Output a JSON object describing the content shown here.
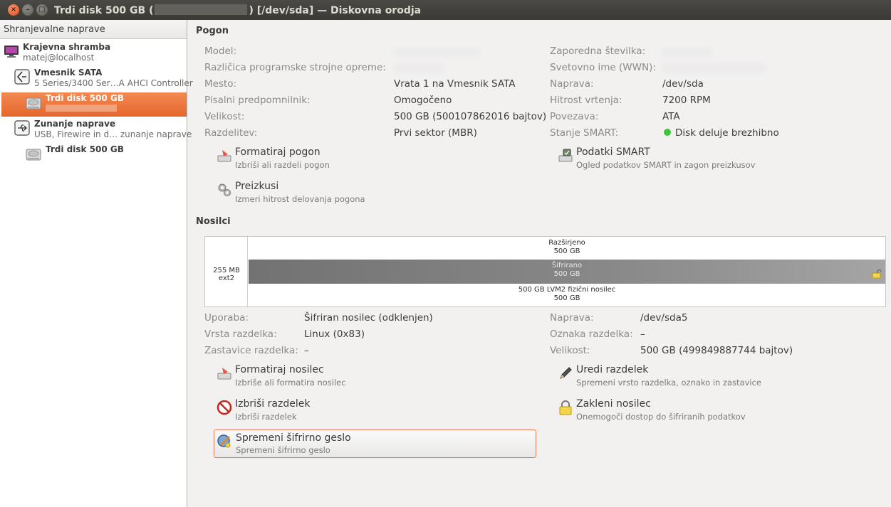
{
  "window": {
    "title_prefix": "Trdi disk 500 GB (",
    "title_suffix": ") [/dev/sda] — Diskovna orodja",
    "close_glyph": "×",
    "minimize_glyph": "–",
    "maximize_glyph": "□"
  },
  "sidebar": {
    "header": "Shranjevalne naprave",
    "items": [
      {
        "title": "Krajevna shramba",
        "subtitle": "matej@localhost",
        "icon": "computer-monitor-icon"
      },
      {
        "title": "Vmesnik SATA",
        "subtitle": "5 Series/3400 Ser…A AHCI Controller",
        "icon": "sata-controller-icon"
      },
      {
        "title": "Trdi disk 500 GB",
        "subtitle": "",
        "icon": "hard-disk-icon",
        "selected": true
      },
      {
        "title": "Zunanje naprave",
        "subtitle": "USB, Firewire in d… zunanje naprave",
        "icon": "usb-icon"
      },
      {
        "title": "Trdi disk 500 GB",
        "subtitle": "",
        "icon": "hard-disk-icon"
      }
    ]
  },
  "drive": {
    "section_title": "Pogon",
    "labels": {
      "model": "Model:",
      "firmware": "Različica programske strojne opreme:",
      "location": "Mesto:",
      "write_cache": "Pisalni predpomnilnik:",
      "size": "Velikost:",
      "partitioning": "Razdelitev:",
      "serial": "Zaporedna številka:",
      "wwn": "Svetovno ime (WWN):",
      "device": "Naprava:",
      "rotation": "Hitrost vrtenja:",
      "connection": "Povezava:",
      "smart_status": "Stanje SMART:"
    },
    "values": {
      "location": "Vrata 1 na Vmesnik SATA",
      "write_cache": "Omogočeno",
      "size": "500 GB (500107862016 bajtov)",
      "partitioning": "Prvi sektor (MBR)",
      "device": "/dev/sda",
      "rotation": "7200 RPM",
      "connection": "ATA",
      "smart_status": "Disk deluje brezhibno"
    },
    "actions": {
      "format_title": "Formatiraj pogon",
      "format_sub": "Izbriši ali razdeli pogon",
      "smart_title": "Podatki SMART",
      "smart_sub": "Ogled podatkov SMART in zagon preizkusov",
      "bench_title": "Preizkusi",
      "bench_sub": "Izmeri hitrost delovanja pogona"
    }
  },
  "volumes": {
    "section_title": "Nosilci",
    "graphic": {
      "part1": "255 MB ext2",
      "extended_name": "Razširjeno",
      "extended_size": "500 GB",
      "encrypted_name": "Šifrirano",
      "encrypted_size": "500 GB",
      "lvm_name": "500 GB LVM2 fizični nosilec",
      "lvm_size": "500 GB"
    },
    "labels": {
      "usage": "Uporaba:",
      "part_type": "Vrsta razdelka:",
      "part_flags": "Zastavice razdelka:",
      "device": "Naprava:",
      "part_label": "Oznaka razdelka:",
      "size": "Velikost:"
    },
    "values": {
      "usage": "Šifriran nosilec (odklenjen)",
      "part_type": "Linux (0x83)",
      "part_flags": "–",
      "device": "/dev/sda5",
      "part_label": "–",
      "size": "500 GB (499849887744 bajtov)"
    },
    "actions": {
      "format_title": "Formatiraj nosilec",
      "format_sub": "Izbriše ali formatira nosilec",
      "edit_title": "Uredi razdelek",
      "edit_sub": "Spremeni vrsto razdelka, oznako in zastavice",
      "delete_title": "Izbriši razdelek",
      "delete_sub": "Izbriši razdelek",
      "lock_title": "Zakleni nosilec",
      "lock_sub": "Onemogoči dostop do šifriranih podatkov",
      "pass_title": "Spremeni šifrirno geslo",
      "pass_sub": "Spremeni šifrirno geslo"
    }
  }
}
